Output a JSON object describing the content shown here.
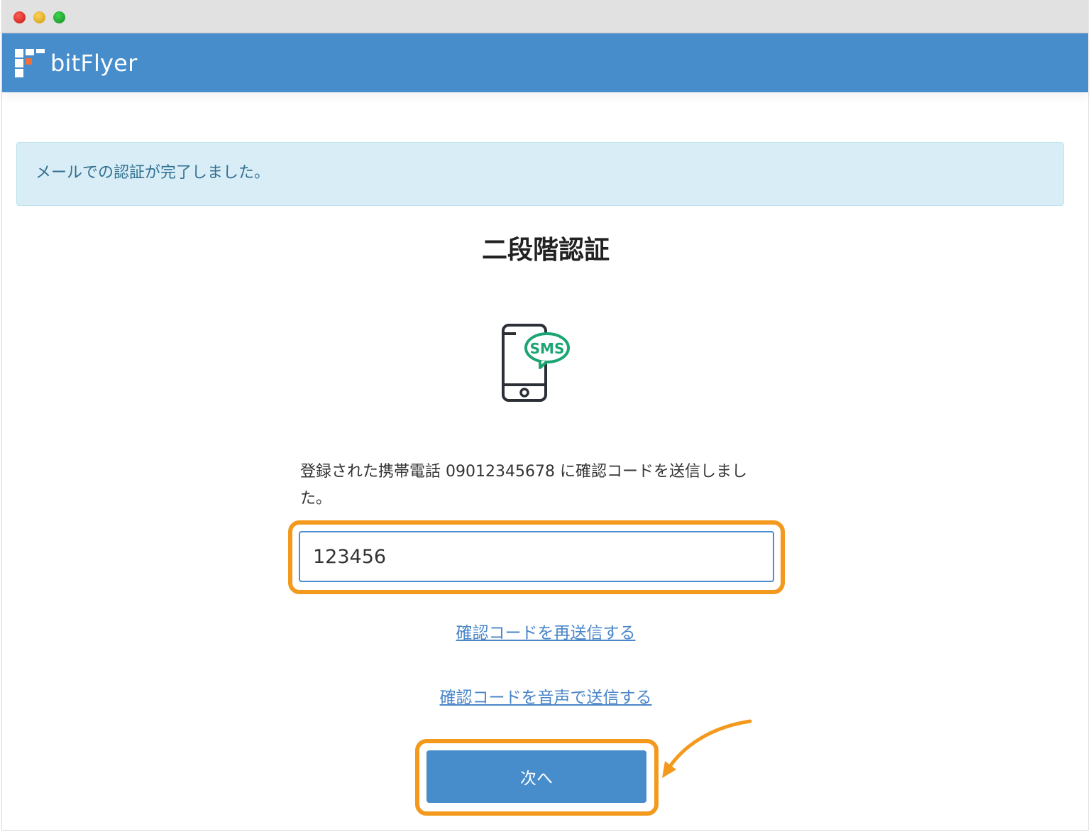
{
  "window": {
    "controls": [
      "close",
      "minimize",
      "zoom"
    ]
  },
  "header": {
    "logo_text": "bitFlyer",
    "logo_icon": "bitflyer-logo-icon",
    "background_color": "#478dcb",
    "logo_accent_color": "#f26f3a"
  },
  "alert": {
    "text": "メールでの認証が完了しました。",
    "background_color": "#d9edf7"
  },
  "main": {
    "title": "二段階認証",
    "sms_icon": "phone-sms-icon",
    "sms_label": "SMS",
    "message": "登録された携帯電話 09012345678 に確認コードを送信しました。",
    "code_input_value": "123456",
    "resend_link": "確認コードを再送信する",
    "voice_link": "確認コードを音声で送信する",
    "next_button": "次へ",
    "highlight_color": "#f39a1e",
    "sms_accent_color": "#1aa572"
  }
}
